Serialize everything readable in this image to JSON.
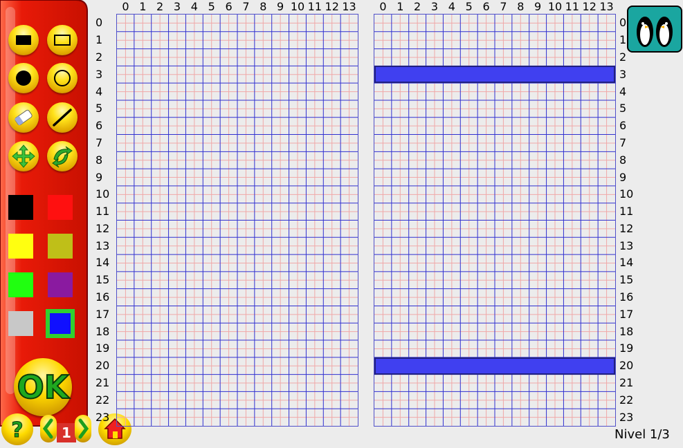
{
  "tools": [
    {
      "name": "filled-rectangle-tool",
      "icon": "filled-rectangle-icon"
    },
    {
      "name": "outline-rectangle-tool",
      "icon": "outline-rectangle-icon"
    },
    {
      "name": "filled-circle-tool",
      "icon": "filled-circle-icon"
    },
    {
      "name": "outline-circle-tool",
      "icon": "outline-circle-icon"
    },
    {
      "name": "eraser-tool",
      "icon": "eraser-icon"
    },
    {
      "name": "line-tool",
      "icon": "line-icon"
    },
    {
      "name": "move-tool",
      "icon": "move-arrows-icon"
    },
    {
      "name": "flip-tool",
      "icon": "flip-icon"
    }
  ],
  "palette": [
    {
      "name": "black",
      "color": "#000000",
      "selected": false
    },
    {
      "name": "red",
      "color": "#ff1010",
      "selected": false
    },
    {
      "name": "yellow",
      "color": "#ffff10",
      "selected": false
    },
    {
      "name": "olive",
      "color": "#bfbf18",
      "selected": false
    },
    {
      "name": "green",
      "color": "#20ff10",
      "selected": false
    },
    {
      "name": "purple",
      "color": "#8a1aa0",
      "selected": false
    },
    {
      "name": "gray",
      "color": "#c8c8c8",
      "selected": false
    },
    {
      "name": "blue",
      "color": "#1010ff",
      "selected": true
    }
  ],
  "ok_button": {
    "label": "OK"
  },
  "nav": {
    "help_icon": "question-icon",
    "prev_icon": "left-arrow-icon",
    "page_number": "1",
    "next_icon": "right-arrow-icon",
    "home_icon": "home-icon"
  },
  "left_grid": {
    "column_labels": [
      "0",
      "1",
      "2",
      "3",
      "4",
      "5",
      "6",
      "7",
      "8",
      "9",
      "10",
      "11",
      "12",
      "13"
    ],
    "row_labels": [
      "0",
      "1",
      "2",
      "3",
      "4",
      "5",
      "6",
      "7",
      "8",
      "9",
      "10",
      "11",
      "12",
      "13",
      "14",
      "15",
      "16",
      "17",
      "18",
      "19",
      "20",
      "21",
      "22",
      "23"
    ]
  },
  "right_grid": {
    "column_labels": [
      "0",
      "1",
      "2",
      "3",
      "4",
      "5",
      "6",
      "7",
      "8",
      "9",
      "10",
      "11",
      "12",
      "13"
    ],
    "row_labels": [
      "0",
      "1",
      "2",
      "3",
      "4",
      "5",
      "6",
      "7",
      "8",
      "9",
      "10",
      "11",
      "12",
      "13",
      "14",
      "15",
      "16",
      "17",
      "18",
      "19",
      "20",
      "21",
      "22",
      "23"
    ],
    "filled_rows": [
      3,
      20
    ],
    "fill_color": "#4040f0"
  },
  "logo_icon": "penguins-logo-icon",
  "level_text": "Nivel 1/3"
}
